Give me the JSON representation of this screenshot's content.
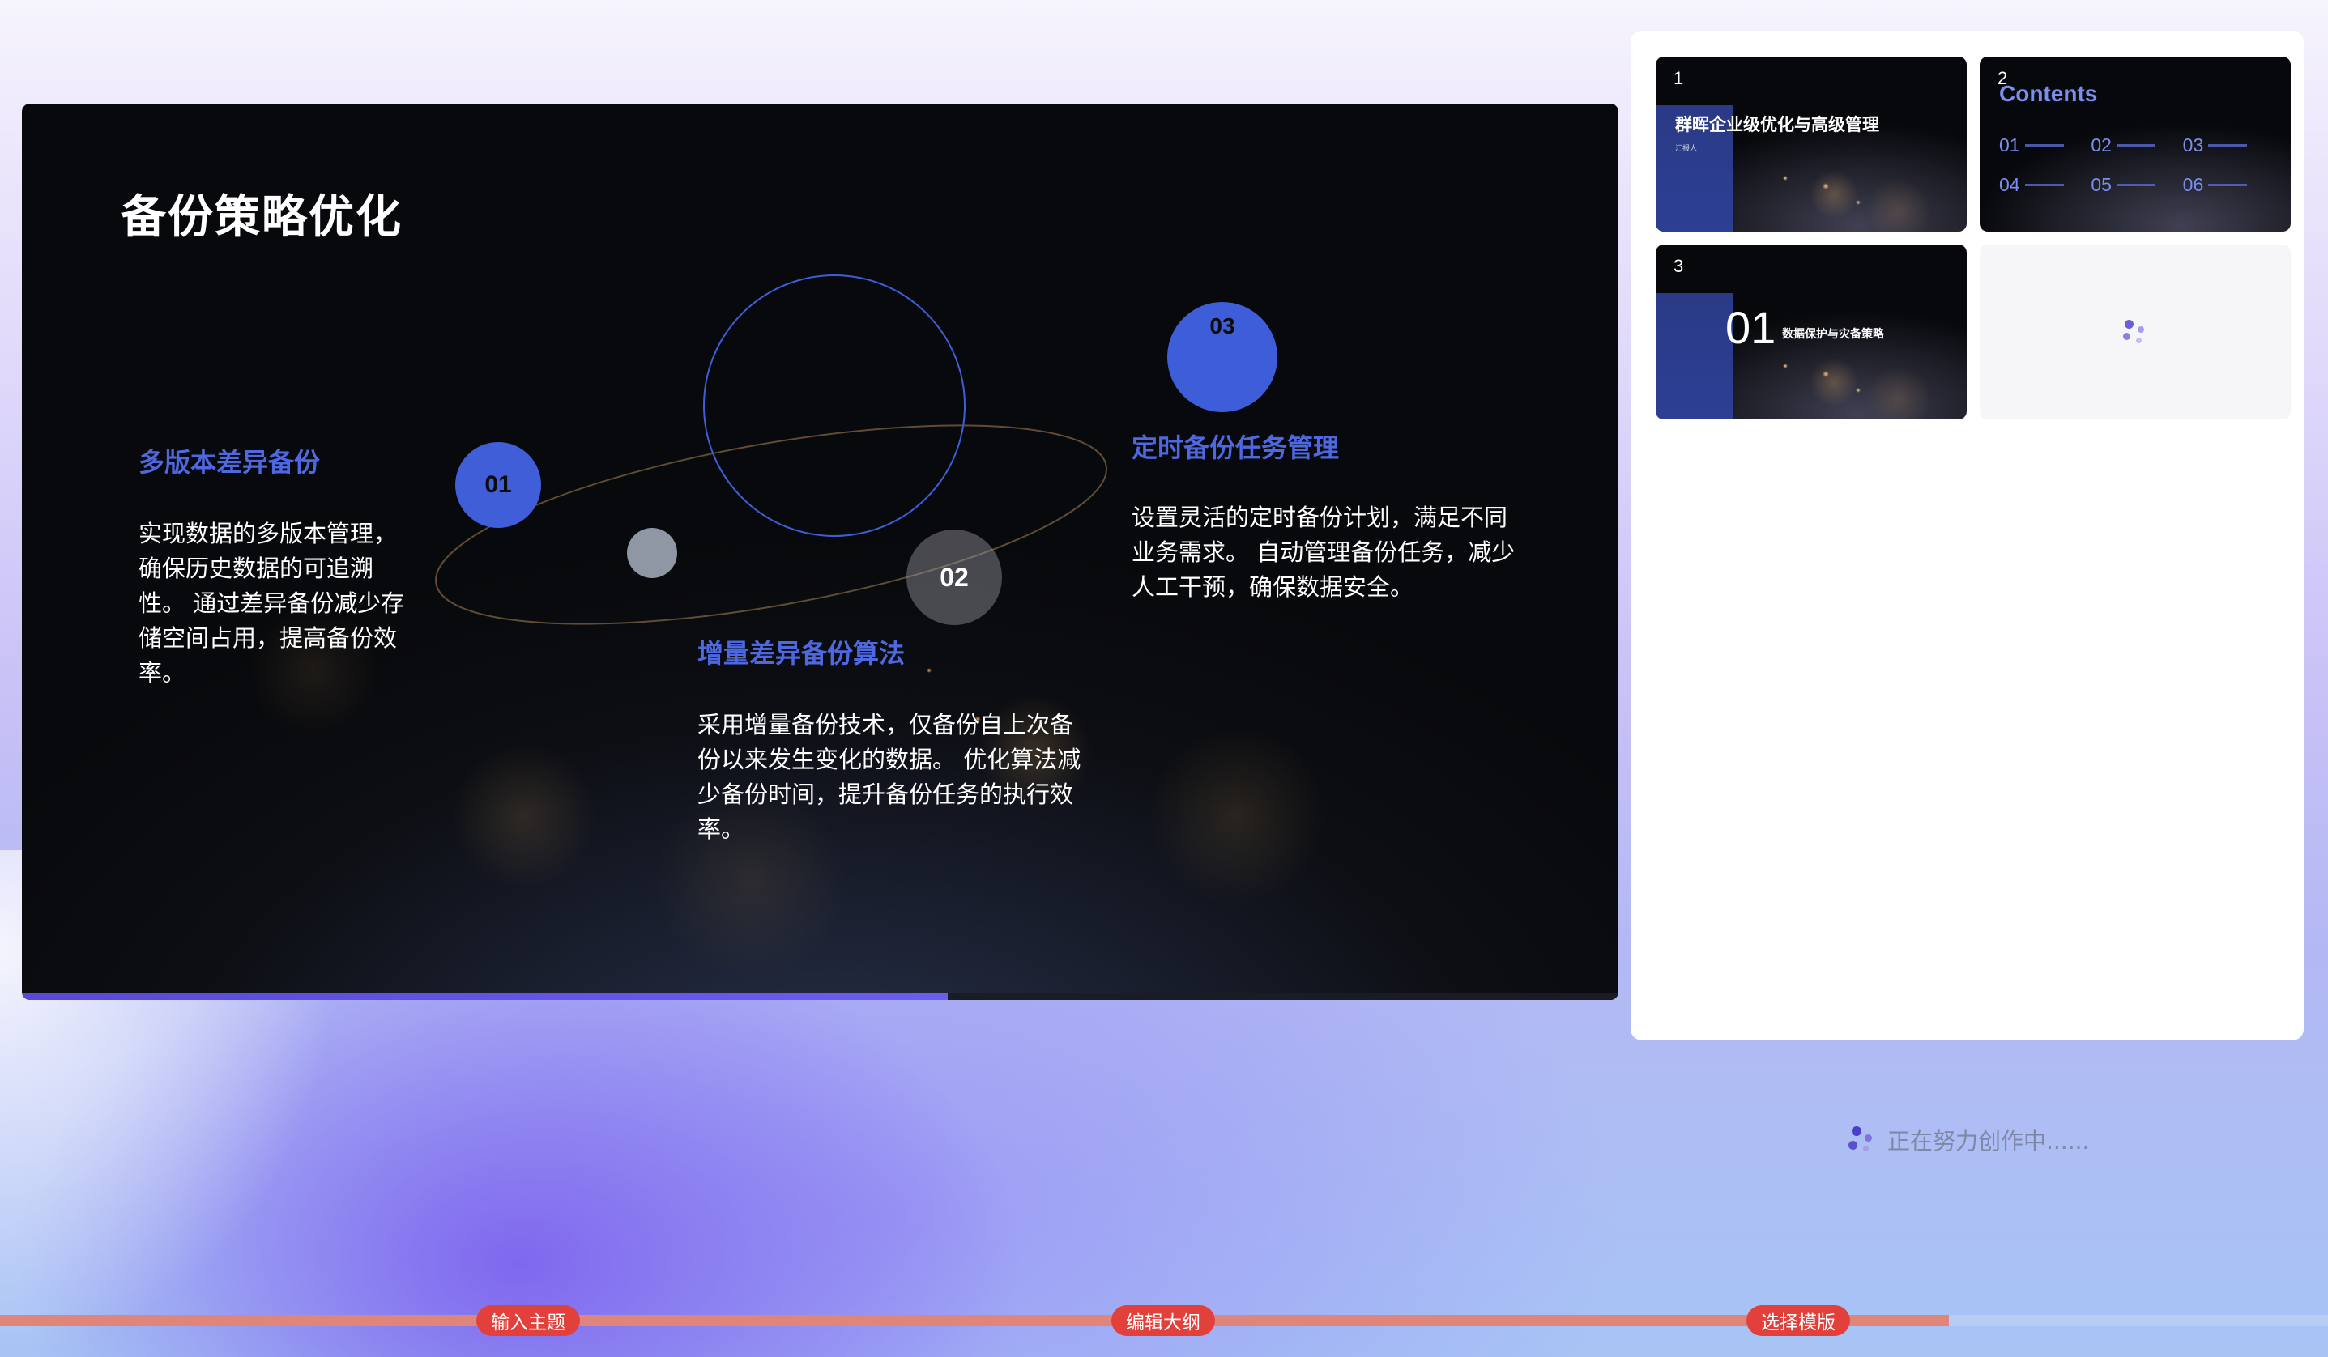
{
  "slide": {
    "title": "备份策略优化",
    "progress_percent": 58,
    "features": [
      {
        "number": "01",
        "title": "多版本差异备份",
        "desc": [
          "实现数据的多版本管理，",
          "确保历史数据的可追溯",
          "性。 通过差异备份减少存",
          "储空间占用，提高备份效",
          "率。"
        ]
      },
      {
        "number": "02",
        "title": "增量差异备份算法",
        "desc": [
          "采用增量备份技术，仅备份自上次备",
          "份以来发生变化的数据。 优化算法减",
          "少备份时间，提升备份任务的执行效",
          "率。"
        ]
      },
      {
        "number": "03",
        "title": "定时备份任务管理",
        "desc": [
          "设置灵活的定时备份计划，满足不同",
          "业务需求。 自动管理备份任务，减少",
          "人工干预，确保数据安全。"
        ]
      }
    ]
  },
  "thumbnails": [
    {
      "number": "1",
      "title": "群晖企业级优化与高级管理",
      "subtitle": "汇报人"
    },
    {
      "number": "2",
      "title": "Contents",
      "items": [
        "01",
        "02",
        "03",
        "04",
        "05",
        "06"
      ]
    },
    {
      "number": "3",
      "big": "01",
      "text": "数据保护与灾备策略"
    }
  ],
  "status": {
    "text": "正在努力创作中......"
  },
  "steps": [
    {
      "label": "输入主题"
    },
    {
      "label": "编辑大纲"
    },
    {
      "label": "选择模版"
    }
  ],
  "colors": {
    "accent": "#4d68e0",
    "step_active": "#e2403b",
    "step_track": "#e0857a",
    "loader": "#6a5fd8"
  }
}
